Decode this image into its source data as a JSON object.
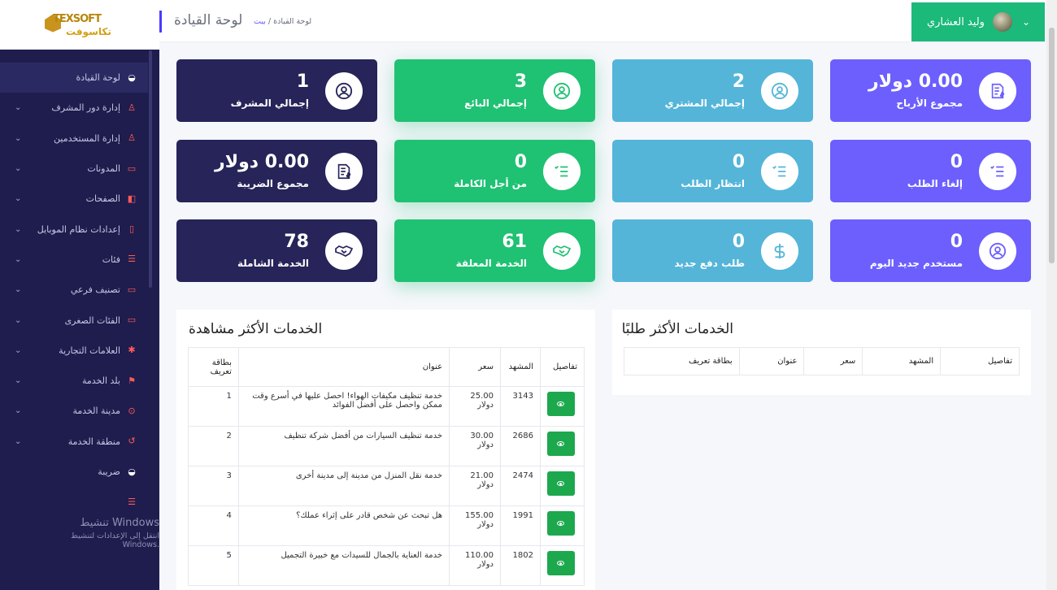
{
  "logo": {
    "top": "TEXSOFT",
    "bottom": "تكاسوفت"
  },
  "header": {
    "page_title": "لوحة القيادة",
    "breadcrumb_home": "بيت",
    "breadcrumb_sep": "/",
    "breadcrumb_current": "لوحة القيادة",
    "user_name": "وليد العشاري"
  },
  "sidebar": {
    "items": [
      {
        "label": "لوحة القيادة",
        "icon": "dashboard-icon"
      },
      {
        "label": "إدارة دور المشرف",
        "icon": "user-icon"
      },
      {
        "label": "إدارة المستخدمين",
        "icon": "user-icon"
      },
      {
        "label": "المدونات",
        "icon": "message-icon"
      },
      {
        "label": "الصفحات",
        "icon": "book-icon"
      },
      {
        "label": "إعدادات نظام الموبايل",
        "icon": "mobile-icon"
      },
      {
        "label": "فئات",
        "icon": "list-icon"
      },
      {
        "label": "تصنيف فرعي",
        "icon": "folder-icon"
      },
      {
        "label": "الفئات الصغرى",
        "icon": "folder-icon"
      },
      {
        "label": "العلامات التجارية",
        "icon": "brand-icon"
      },
      {
        "label": "بلد الخدمة",
        "icon": "flag-icon"
      },
      {
        "label": "مدينة الخدمة",
        "icon": "circle-icon"
      },
      {
        "label": "منطقة الخدمة",
        "icon": "location-icon"
      },
      {
        "label": "ضريبة",
        "icon": "dashboard-icon"
      },
      {
        "label": "",
        "icon": "list-icon"
      }
    ]
  },
  "windows_watermark": {
    "line1": "تنشيط Windows",
    "line2": "انتقل إلى الإعدادات لتنشيط Windows."
  },
  "cards": [
    {
      "value": "1",
      "label": "إجمالي المشرف",
      "color": "#262459",
      "icon": "user-circle-icon"
    },
    {
      "value": "3",
      "label": "إجمالي البائع",
      "color": "#1fc173",
      "icon": "user-circle-icon"
    },
    {
      "value": "2",
      "label": "إجمالي المشتري",
      "color": "#54b5d9",
      "icon": "user-circle-icon"
    },
    {
      "value": "0.00 دولار",
      "label": "مجموع الأرباح",
      "color": "#6c5ffe",
      "icon": "invoice-icon"
    },
    {
      "value": "0.00 دولار",
      "label": "مجموع الضريبة",
      "color": "#262459",
      "icon": "invoice-icon"
    },
    {
      "value": "0",
      "label": "من أجل الكاملة",
      "color": "#1fc173",
      "icon": "checklist-icon"
    },
    {
      "value": "0",
      "label": "انتظار الطلب",
      "color": "#54b5d9",
      "icon": "checklist-icon"
    },
    {
      "value": "0",
      "label": "إلغاء الطلب",
      "color": "#6c5ffe",
      "icon": "checklist-icon"
    },
    {
      "value": "78",
      "label": "الخدمة الشاملة",
      "color": "#262459",
      "icon": "handshake-icon"
    },
    {
      "value": "61",
      "label": "الخدمة المعلقة",
      "color": "#1fc173",
      "icon": "handshake-icon"
    },
    {
      "value": "0",
      "label": "طلب دفع جديد",
      "color": "#54b5d9",
      "icon": "dollar-icon"
    },
    {
      "value": "0",
      "label": "مستخدم جديد اليوم",
      "color": "#6c5ffe",
      "icon": "user-circle-icon"
    }
  ],
  "most_viewed": {
    "title": "الخدمات الأكثر مشاهدة",
    "headers": {
      "details": "تفاصيل",
      "views": "المشهد",
      "price": "سعر",
      "title": "عنوان",
      "id": "بطاقة تعريف"
    },
    "rows": [
      {
        "id": "1",
        "title": "خدمة تنظيف مكيفات الهواء! احصل عليها في أسرع وقت ممكن واحصل على أفضل الفوائد",
        "price": "25.00 دولار",
        "views": "3143"
      },
      {
        "id": "2",
        "title": "خدمة تنظيف السيارات من أفضل شركة تنظيف",
        "price": "30.00 دولار",
        "views": "2686"
      },
      {
        "id": "3",
        "title": "خدمة نقل المنزل من مدينة إلى مدينة أخرى",
        "price": "21.00 دولار",
        "views": "2474"
      },
      {
        "id": "4",
        "title": "هل تبحث عن شخص قادر على إثراء عملك؟",
        "price": "155.00 دولار",
        "views": "1991"
      },
      {
        "id": "5",
        "title": "خدمة العناية بالجمال للسيدات مع خبيرة التجميل",
        "price": "110.00 دولار",
        "views": "1802"
      }
    ]
  },
  "most_requested": {
    "title": "الخدمات الأكثر طلبًا",
    "headers": {
      "details": "تفاصيل",
      "views": "المشهد",
      "price": "سعر",
      "title": "عنوان",
      "id": "بطاقة تعريف"
    }
  }
}
